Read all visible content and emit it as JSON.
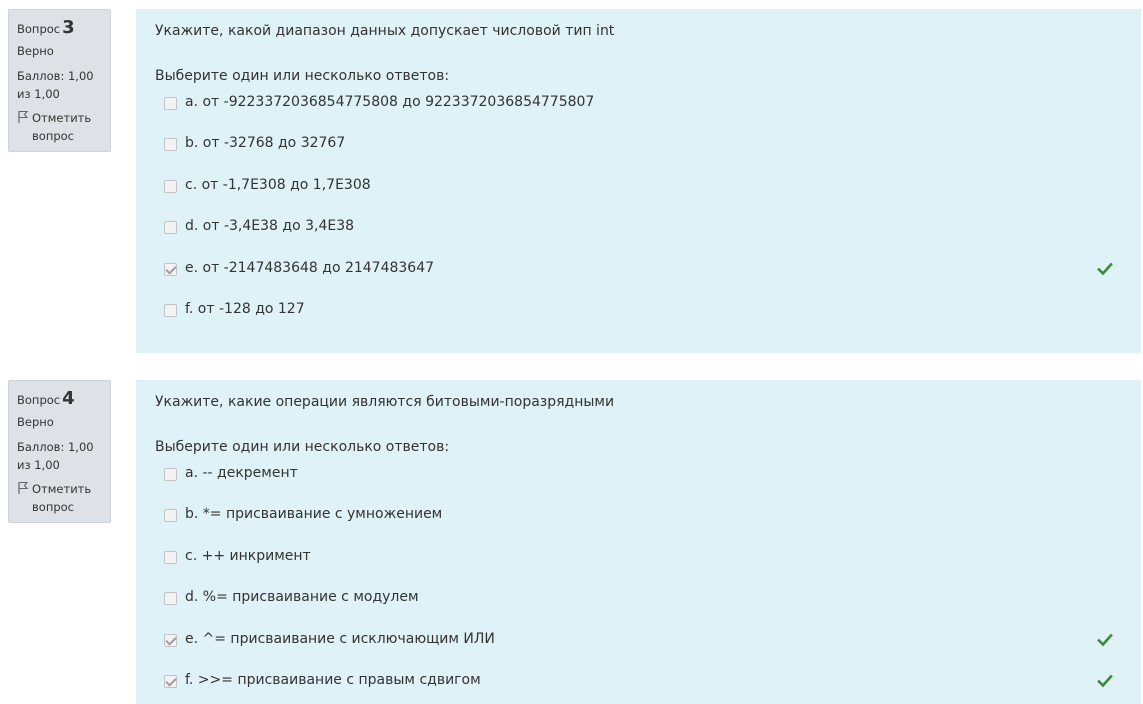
{
  "questions": [
    {
      "word": "Вопрос",
      "number": "3",
      "state": "Верно",
      "grade": "Баллов: 1,00 из 1,00",
      "flag_label": "Отметить вопрос",
      "text": "Укажите, какой диапазон данных допускает числовой тип int",
      "prompt": "Выберите один или несколько ответов:",
      "answers": [
        {
          "label": "a. от -9223372036854775808 до 9223372036854775807",
          "checked": false,
          "correct": false
        },
        {
          "label": "b. от -32768 до 32767",
          "checked": false,
          "correct": false
        },
        {
          "label": "c. от -1,7E308 до 1,7E308",
          "checked": false,
          "correct": false
        },
        {
          "label": "d. от -3,4E38 до 3,4E38",
          "checked": false,
          "correct": false
        },
        {
          "label": "e. от -2147483648 до 2147483647",
          "checked": true,
          "correct": true
        },
        {
          "label": "f. от -128 до 127",
          "checked": false,
          "correct": false
        }
      ]
    },
    {
      "word": "Вопрос",
      "number": "4",
      "state": "Верно",
      "grade": "Баллов: 1,00 из 1,00",
      "flag_label": "Отметить вопрос",
      "text": "Укажите, какие операции являются битовыми-поразрядными",
      "prompt": "Выберите один или несколько ответов:",
      "answers": [
        {
          "label": "a. -- декремент",
          "checked": false,
          "correct": false
        },
        {
          "label": "b. *= присваивание с умножением",
          "checked": false,
          "correct": false
        },
        {
          "label": "c. ++ инкримент",
          "checked": false,
          "correct": false
        },
        {
          "label": "d. %= присваивание с модулем",
          "checked": false,
          "correct": false
        },
        {
          "label": "e. ^= присваивание с исключающим ИЛИ",
          "checked": true,
          "correct": true
        },
        {
          "label": "f. >>= присваивание с правым сдвигом",
          "checked": true,
          "correct": true
        }
      ]
    }
  ],
  "colors": {
    "content_bg": "#def2f8",
    "info_bg": "#dee2e6",
    "correct_tick": "#3a8a3a"
  }
}
